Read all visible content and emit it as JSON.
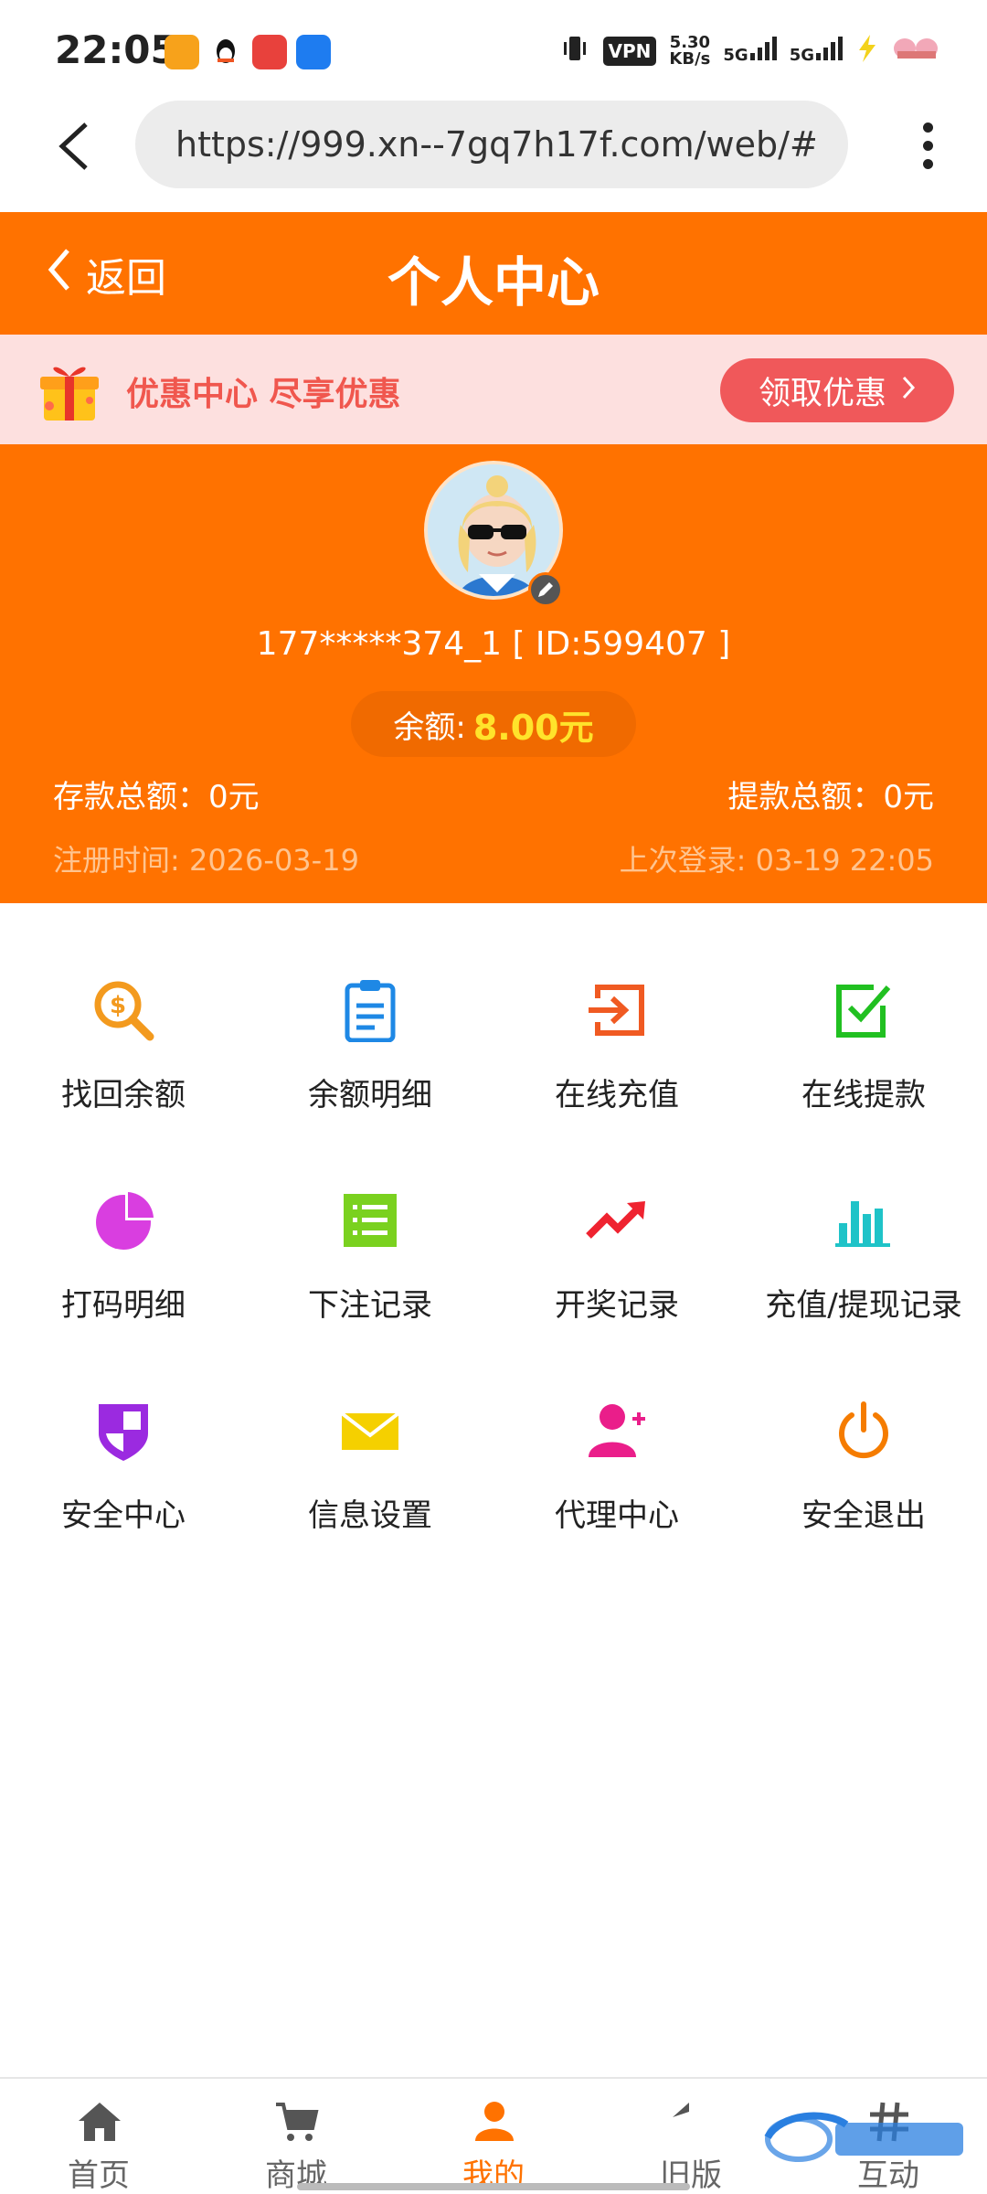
{
  "status_bar": {
    "time": "22:05",
    "vpn_label": "VPN",
    "speed_value": "5.30",
    "speed_unit": "KB/s",
    "network_1": "5G",
    "network_2": "5G"
  },
  "browser": {
    "url": "https://999.xn--7gq7h17f.com/web/#/"
  },
  "header": {
    "back_label": "返回",
    "title": "个人中心"
  },
  "promo": {
    "text": "优惠中心 尽享优惠",
    "button_label": "领取优惠",
    "button_arrow": "›"
  },
  "profile": {
    "user_id": "177*****374_1 [ ID:599407 ]",
    "balance_label": "余额:",
    "balance_value": "8.00元",
    "deposit_total": "存款总额：0元",
    "withdraw_total": "提款总额：0元",
    "register_time": "注册时间: 2026-03-19",
    "last_login": "上次登录: 03-19 22:05"
  },
  "menu": [
    {
      "label": "找回余额",
      "icon": "dollar-search-icon",
      "color": "#f39a1e"
    },
    {
      "label": "余额明细",
      "icon": "clipboard-icon",
      "color": "#1e88e5"
    },
    {
      "label": "在线充值",
      "icon": "login-box-icon",
      "color": "#f05a22"
    },
    {
      "label": "在线提款",
      "icon": "checkbox-icon",
      "color": "#21c021"
    },
    {
      "label": "打码明细",
      "icon": "pie-chart-icon",
      "color": "#d93ee0"
    },
    {
      "label": "下注记录",
      "icon": "list-icon",
      "color": "#7ad11f"
    },
    {
      "label": "开奖记录",
      "icon": "trend-up-icon",
      "color": "#ef2330"
    },
    {
      "label": "充值/提现记录",
      "icon": "bar-chart-icon",
      "color": "#1fc3c8"
    },
    {
      "label": "安全中心",
      "icon": "shield-icon",
      "color": "#9b2ae0"
    },
    {
      "label": "信息设置",
      "icon": "envelope-icon",
      "color": "#f5d000"
    },
    {
      "label": "代理中心",
      "icon": "add-user-icon",
      "color": "#ea1e8a"
    },
    {
      "label": "安全退出",
      "icon": "power-icon",
      "color": "#f57c00"
    }
  ],
  "bottom_nav": [
    {
      "label": "首页",
      "icon": "home-icon"
    },
    {
      "label": "商城",
      "icon": "cart-icon"
    },
    {
      "label": "我的",
      "icon": "user-icon",
      "active": true
    },
    {
      "label": "旧版",
      "icon": "reply-icon"
    },
    {
      "label": "互动",
      "icon": "hash-icon"
    }
  ],
  "colors": {
    "brand_orange": "#ff7200",
    "promo_bg": "#fde0df",
    "promo_red": "#f0574e",
    "balance_yellow": "#ffe32b"
  }
}
